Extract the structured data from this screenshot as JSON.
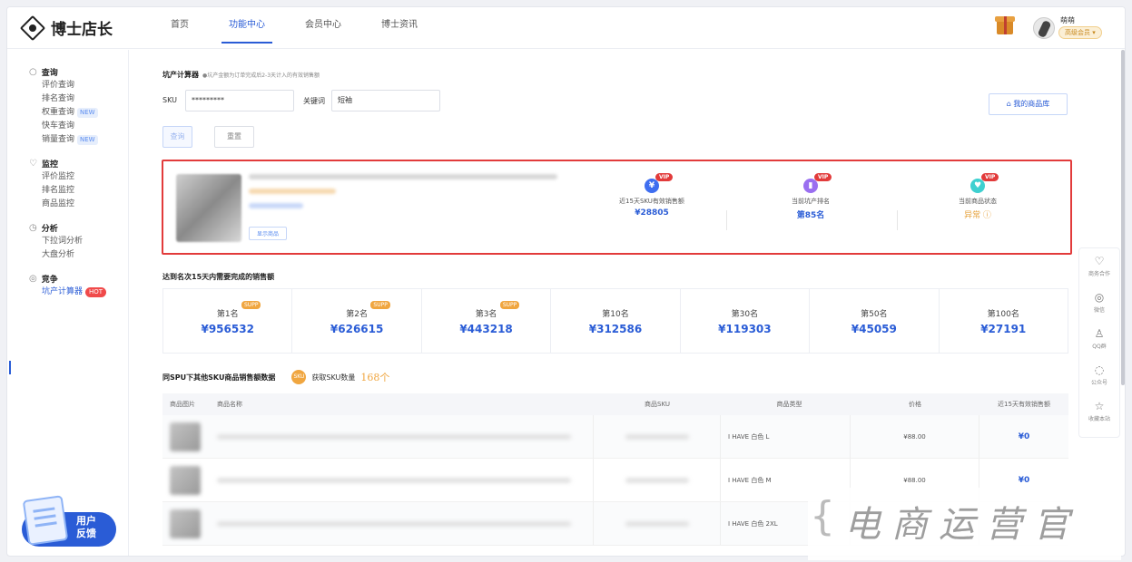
{
  "app": {
    "logo_text": "博士店长"
  },
  "nav": {
    "items": [
      "首页",
      "功能中心",
      "会员中心",
      "博士资讯"
    ],
    "active_index": 1
  },
  "user": {
    "name": "萌萌",
    "badge": "高级会员 ▾"
  },
  "sidebar": {
    "sections": [
      {
        "title": "查询",
        "icon": "search-icon",
        "items": [
          {
            "label": "评价查询",
            "tag": ""
          },
          {
            "label": "排名查询",
            "tag": ""
          },
          {
            "label": "权重查询",
            "tag": "NEW"
          },
          {
            "label": "快车查询",
            "tag": ""
          },
          {
            "label": "销量查询",
            "tag": "NEW"
          }
        ]
      },
      {
        "title": "监控",
        "icon": "monitor-icon",
        "items": [
          {
            "label": "评价监控",
            "tag": ""
          },
          {
            "label": "排名监控",
            "tag": ""
          },
          {
            "label": "商品监控",
            "tag": ""
          }
        ]
      },
      {
        "title": "分析",
        "icon": "clock-icon",
        "items": [
          {
            "label": "下拉词分析",
            "tag": ""
          },
          {
            "label": "大盘分析",
            "tag": ""
          }
        ]
      },
      {
        "title": "竞争",
        "icon": "target-icon",
        "items": [
          {
            "label": "坑产计算器",
            "tag": "HOT"
          }
        ]
      }
    ],
    "feedback": {
      "line1": "用户",
      "line2": "反馈"
    }
  },
  "calculator": {
    "title": "坑产计算器",
    "hint": "●坑产金额为订单完成后2-3天计入的有效销售额",
    "sku_label": "SKU",
    "sku_value": "*********",
    "keyword_label": "关键词",
    "keyword_value": "短袖",
    "query_button": "查询",
    "reset_button": "重置",
    "library_button": "我的商品库"
  },
  "product_card": {
    "show_button": "显示商品",
    "vip_tag": "VIP",
    "stats": [
      {
        "label": "近15天SKU有效销售额",
        "value": "¥28805",
        "icon_char": "¥",
        "color": "#3f6ef0"
      },
      {
        "label": "当前坑产排名",
        "value": "第85名",
        "icon_char": "▮",
        "color": "#9a6ff0"
      },
      {
        "label": "当前商品状态",
        "value": "异常 ⓘ",
        "icon_char": "♥",
        "color": "#3fd0d0"
      }
    ]
  },
  "ranking": {
    "title": "达到名次15天内需要完成的销售额",
    "supp_tag": "SUPP",
    "items": [
      {
        "name": "第1名",
        "value": "¥956532",
        "supp": true
      },
      {
        "name": "第2名",
        "value": "¥626615",
        "supp": true
      },
      {
        "name": "第3名",
        "value": "¥443218",
        "supp": true
      },
      {
        "name": "第10名",
        "value": "¥312586",
        "supp": false
      },
      {
        "name": "第30名",
        "value": "¥119303",
        "supp": false
      },
      {
        "name": "第50名",
        "value": "¥45059",
        "supp": false
      },
      {
        "name": "第100名",
        "value": "¥27191",
        "supp": false
      }
    ]
  },
  "spu": {
    "title": "同SPU下其他SKU商品销售额数据",
    "sku_icon": "SKU",
    "count_label": "获取SKU数量",
    "count_value": "168个",
    "columns": [
      "商品图片",
      "商品名称",
      "商品SKU",
      "商品类型",
      "价格",
      "近15天有效销售额"
    ],
    "rows": [
      {
        "type": "I HAVE 白色  L",
        "price": "¥88.00",
        "sales": "¥0"
      },
      {
        "type": "I HAVE 白色  M",
        "price": "¥88.00",
        "sales": "¥0"
      },
      {
        "type": "I HAVE 白色  2XL",
        "price": "",
        "sales": ""
      }
    ]
  },
  "float_bar": [
    {
      "label": "商务合作",
      "icon": "handshake-icon",
      "glyph": "♡"
    },
    {
      "label": "微信",
      "icon": "wechat-icon",
      "glyph": "◎"
    },
    {
      "label": "QQ群",
      "icon": "qq-icon",
      "glyph": "♙"
    },
    {
      "label": "公众号",
      "icon": "chat-icon",
      "glyph": "◌"
    },
    {
      "label": "收藏本站",
      "icon": "star-icon",
      "glyph": "☆"
    }
  ],
  "watermark": "电商运营官"
}
